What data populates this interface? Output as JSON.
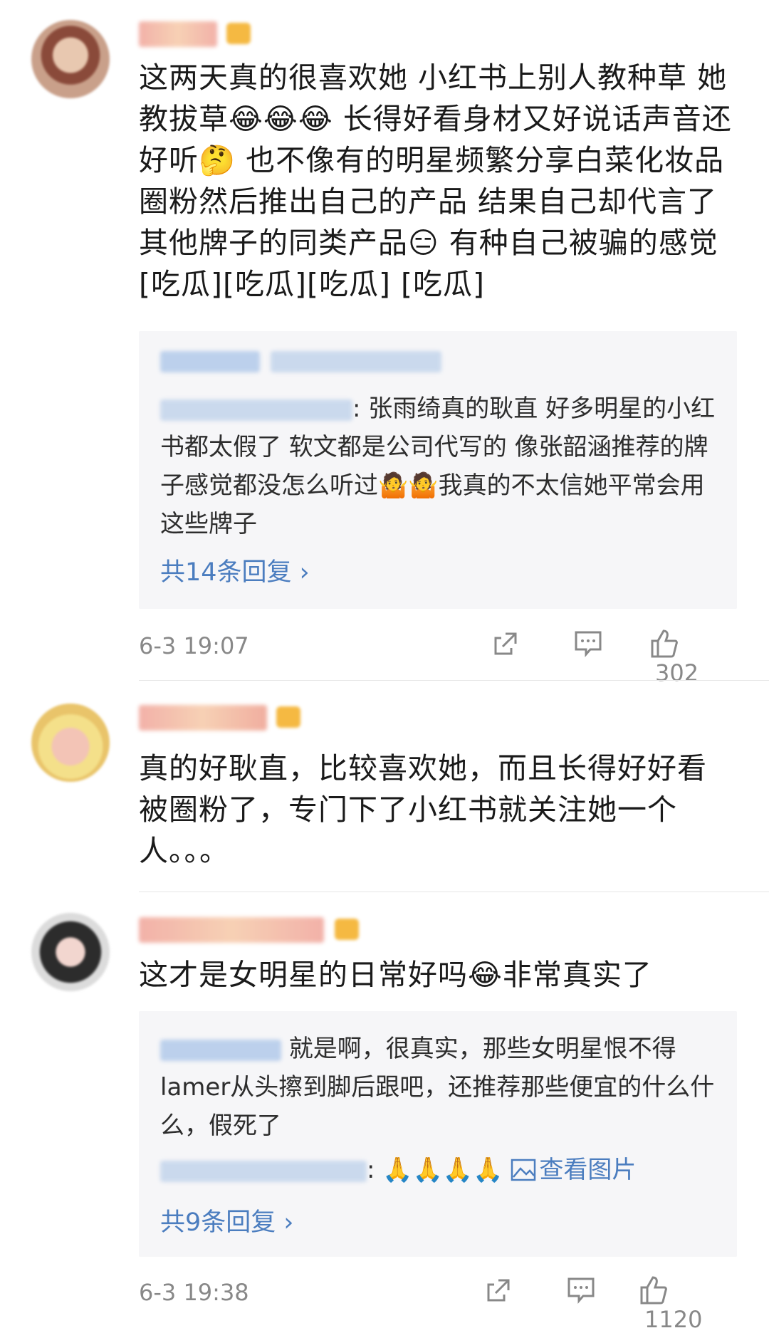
{
  "comments": [
    {
      "text": "这两天真的很喜欢她 小红书上别人教种草 她教拔草😂😂😂 长得好看身材又好说话声音还好听🤔 也不像有的明星频繁分享白菜化妆品圈粉然后推出自己的产品 结果自己却代言了其他牌子的同类产品😑 有种自己被骗的感觉[吃瓜][吃瓜][吃瓜] [吃瓜]",
      "reply": {
        "text": ": 张雨绮真的耿直 好多明星的小红书都太假了 软文都是公司代写的 像张韶涵推荐的牌子感觉都没怎么听过🤷🤷我真的不太信她平常会用这些牌子",
        "more": "共14条回复 ›"
      },
      "time": "6-3 19:07",
      "likes": "302"
    },
    {
      "text": "真的好耿直，比较喜欢她，而且长得好好看被圈粉了，专门下了小红书就关注她一个人。。。"
    },
    {
      "text": "这才是女明星的日常好吗😂非常真实了",
      "replies": [
        {
          "text": " 就是啊，很真实，那些女明星恨不得lamer从头擦到脚后跟吧，还推荐那些便宜的什么什么，假死了"
        },
        {
          "text": ": 🙏🙏🙏🙏 ",
          "link": "查看图片"
        }
      ],
      "more": "共9条回复 ›",
      "time": "6-3 19:38",
      "likes": "1120"
    }
  ],
  "icons": [
    "share-icon",
    "comment-icon",
    "like-icon",
    "chevron-right-icon",
    "image-icon"
  ],
  "colors": {
    "link": "#4b7dbf",
    "meta": "#888888",
    "reply_bg": "#f6f6f8"
  }
}
